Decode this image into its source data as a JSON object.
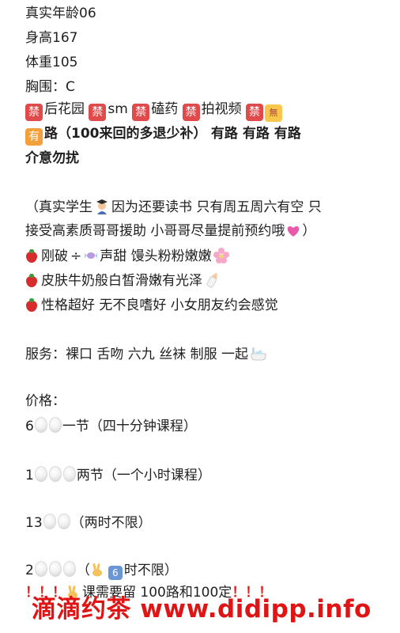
{
  "colors": {
    "accent_red": "#e01414",
    "badge_red": "#e04a4a",
    "badge_orange": "#f4a03a",
    "text": "#1f1f1f"
  },
  "profile": {
    "age": "真实年龄06",
    "height": "身高167",
    "weight": "体重105",
    "bust": "胸围：C"
  },
  "restrictions": {
    "badge_forbidden": "禁",
    "badge_none": "無",
    "items": [
      "后花园",
      "sm",
      "磕药",
      "拍视频"
    ]
  },
  "allowed": {
    "badge_have": "有",
    "text_1": "路（100来回的多退少补）",
    "text_2": "有路 有路 有路"
  },
  "note_disturb": "介意勿扰",
  "intro": {
    "line1_a": "（真实学生",
    "line1_b": "因为还要读书 只有周五周六有空  只",
    "line2": "接受高素质哥哥援助 小哥哥尽量提前预约哦",
    "line2_end": "）",
    "student_icon": "student-icon",
    "heart_icon": "heart-icon"
  },
  "features": [
    {
      "icon": "strawberry-icon",
      "text_a": "刚破",
      "text_b": "声甜 馒头粉粉嫩嫩"
    },
    {
      "icon": "strawberry-icon",
      "text_a": "皮肤牛奶般白皙滑嫩有光泽"
    },
    {
      "icon": "strawberry-icon",
      "text_a": "性格超好 无不良嗜好 小女朋友约会感觉"
    }
  ],
  "services": {
    "text": "服务：裸口  舌吻   六九  丝袜  制服  一起",
    "icon": "bathtub-icon"
  },
  "pricing": {
    "label": "价格：",
    "rows": [
      {
        "prefix": "6",
        "suffix": "一节（四十分钟课程）"
      },
      {
        "prefix": "1",
        "suffix": "两节（一个小时课程）"
      },
      {
        "prefix": "13",
        "suffix": "（两时不限）"
      },
      {
        "prefix": "2",
        "suffix_a": "（",
        "suffix_b": "时不限）",
        "num_badge": "6"
      }
    ]
  },
  "footer_note": "课需要留 100路和100定",
  "watermark": "滴滴约茶 www.didipp.info"
}
